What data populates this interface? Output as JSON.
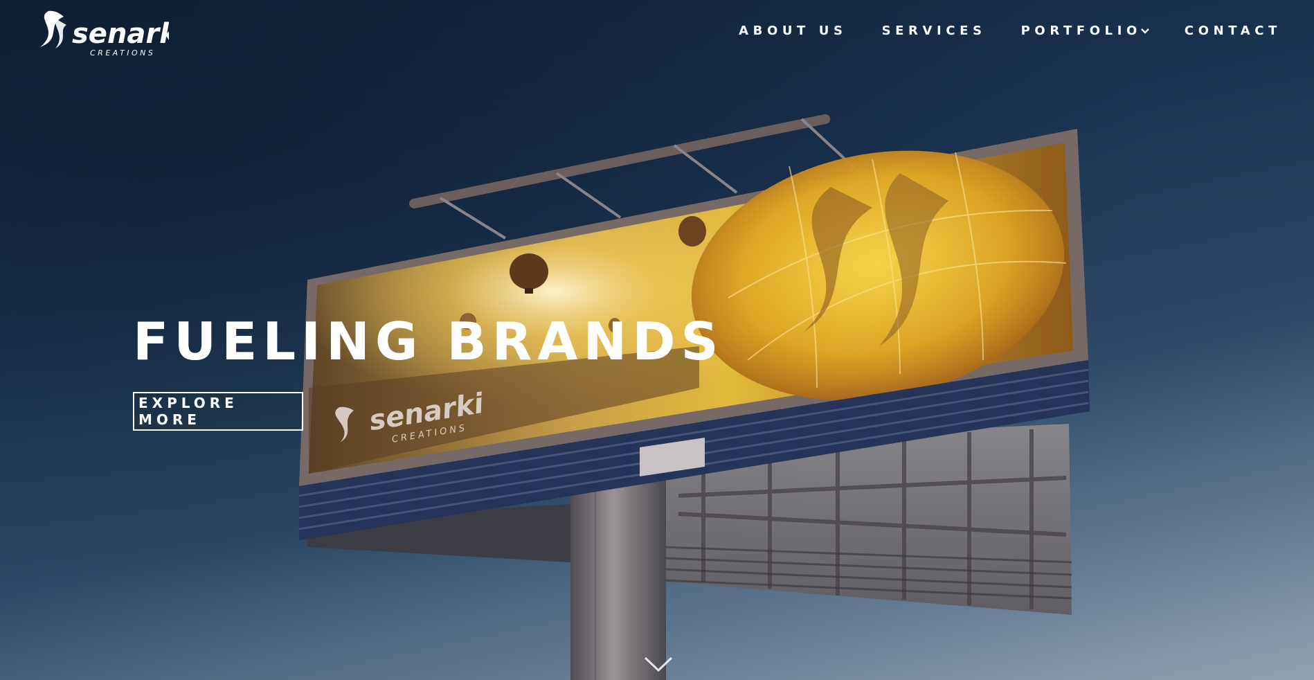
{
  "brand": {
    "name": "senarki",
    "tagline": "CREATIONS"
  },
  "nav": {
    "items": [
      {
        "label": "ABOUT US",
        "has_dropdown": false
      },
      {
        "label": "SERVICES",
        "has_dropdown": false
      },
      {
        "label": "PORTFOLIO",
        "has_dropdown": true
      },
      {
        "label": "CONTACT",
        "has_dropdown": false
      }
    ],
    "dropdown_icon": "chevron-down-icon"
  },
  "hero": {
    "headline": "FUELING BRANDS",
    "cta_label": "EXPLORE MORE",
    "scroll_icon": "chevron-down-icon",
    "billboard_logo": "senarki",
    "billboard_tagline": "CREATIONS"
  },
  "colors": {
    "sky_top": "#12233a",
    "sky_bottom": "#93a2b1",
    "text": "#ffffff",
    "billboard_glow": "#f2c232",
    "billboard_stripes": "#26345a"
  }
}
